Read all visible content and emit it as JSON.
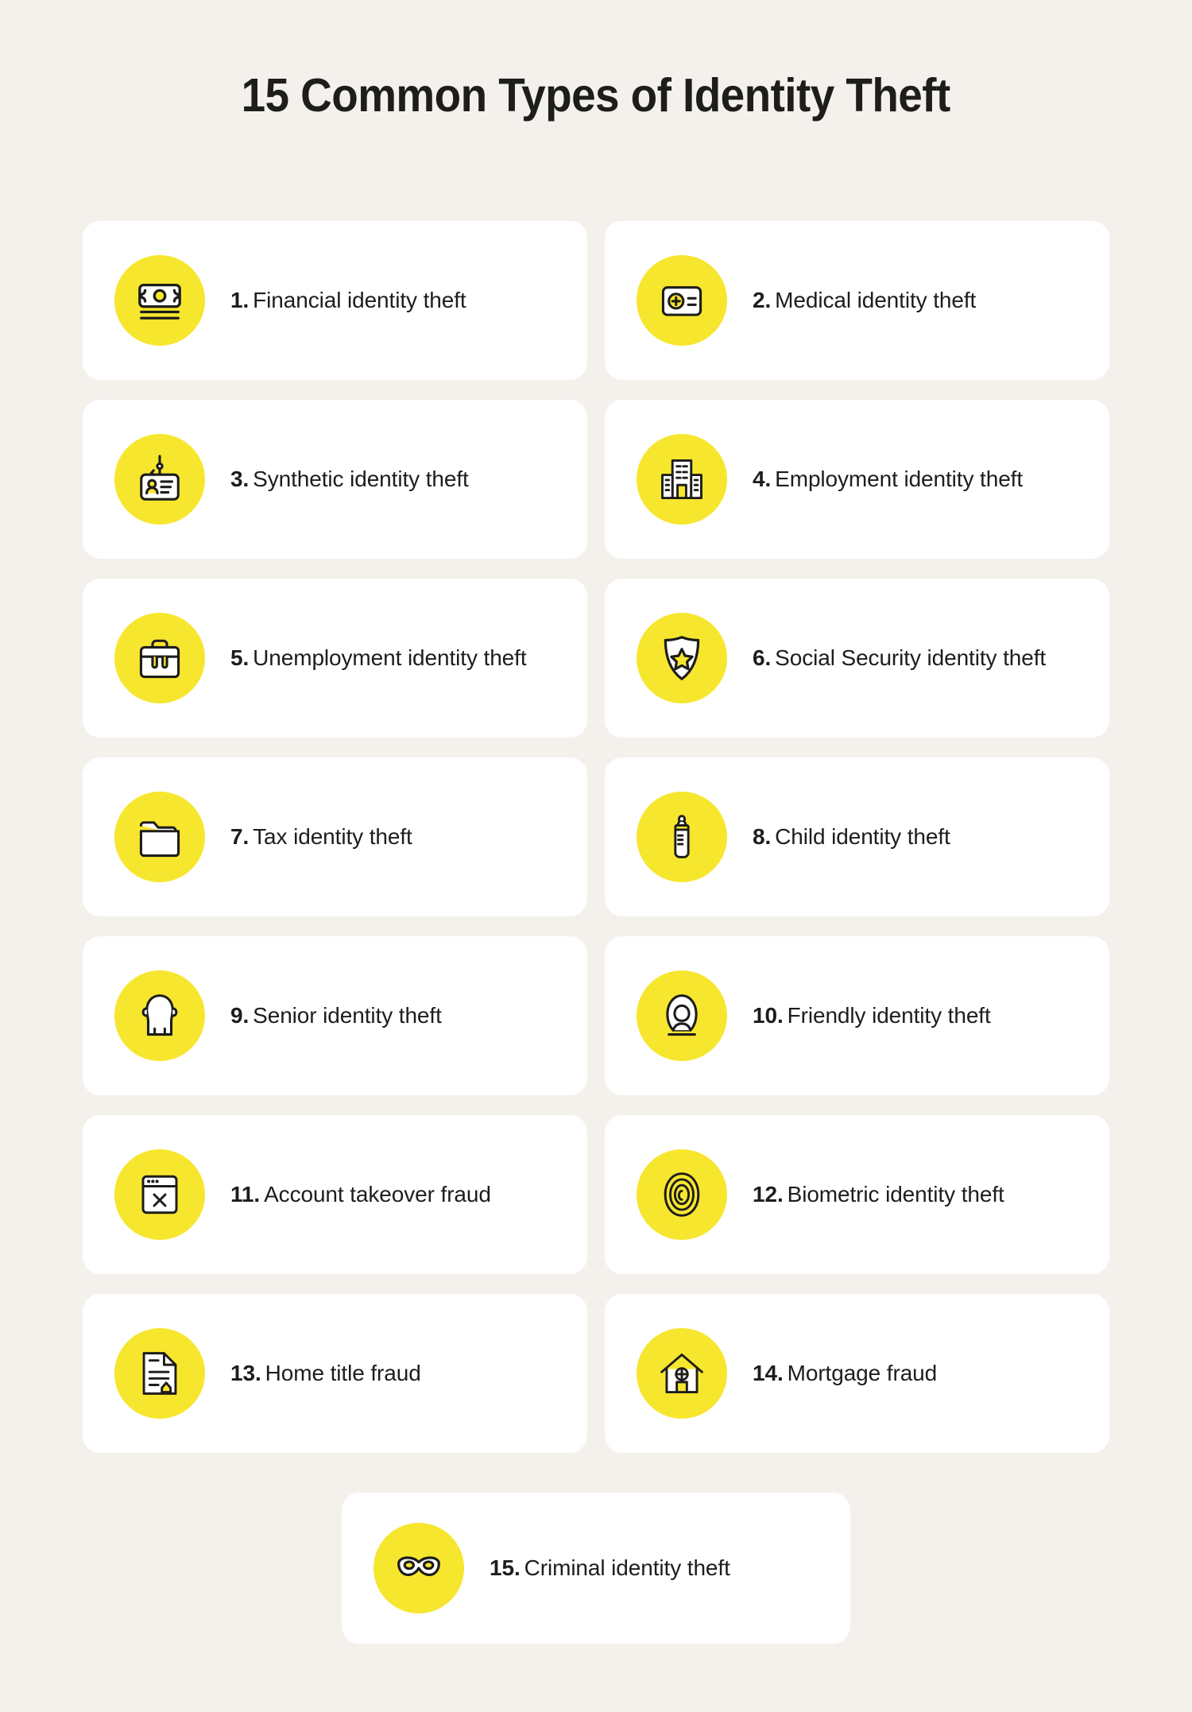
{
  "page": {
    "title": "15 Common Types of Identity Theft",
    "background_color": "#F4F1EC",
    "card_color": "#FFFFFF",
    "accent_color": "#F7E62E",
    "text_color": "#1D1D1B"
  },
  "items": [
    {
      "number": "1.",
      "label": "Financial identity theft",
      "icon": "banknote-icon"
    },
    {
      "number": "2.",
      "label": "Medical identity theft",
      "icon": "medical-card-icon"
    },
    {
      "number": "3.",
      "label": "Synthetic identity theft",
      "icon": "id-badge-hook-icon"
    },
    {
      "number": "4.",
      "label": "Employment identity theft",
      "icon": "office-building-icon"
    },
    {
      "number": "5.",
      "label": "Unemployment identity theft",
      "icon": "briefcase-icon"
    },
    {
      "number": "6.",
      "label": "Social Security identity theft",
      "icon": "shield-star-icon"
    },
    {
      "number": "7.",
      "label": "Tax identity theft",
      "icon": "folder-icon"
    },
    {
      "number": "8.",
      "label": "Child identity theft",
      "icon": "baby-bottle-icon"
    },
    {
      "number": "9.",
      "label": "Senior identity theft",
      "icon": "senior-head-icon"
    },
    {
      "number": "10.",
      "label": "Friendly identity theft",
      "icon": "hooded-person-icon"
    },
    {
      "number": "11.",
      "label": "Account takeover fraud",
      "icon": "browser-window-x-icon"
    },
    {
      "number": "12.",
      "label": "Biometric identity theft",
      "icon": "fingerprint-icon"
    },
    {
      "number": "13.",
      "label": "Home title fraud",
      "icon": "house-document-icon"
    },
    {
      "number": "14.",
      "label": "Mortgage fraud",
      "icon": "house-icon"
    },
    {
      "number": "15.",
      "label": "Criminal identity theft",
      "icon": "bandit-mask-icon"
    }
  ]
}
